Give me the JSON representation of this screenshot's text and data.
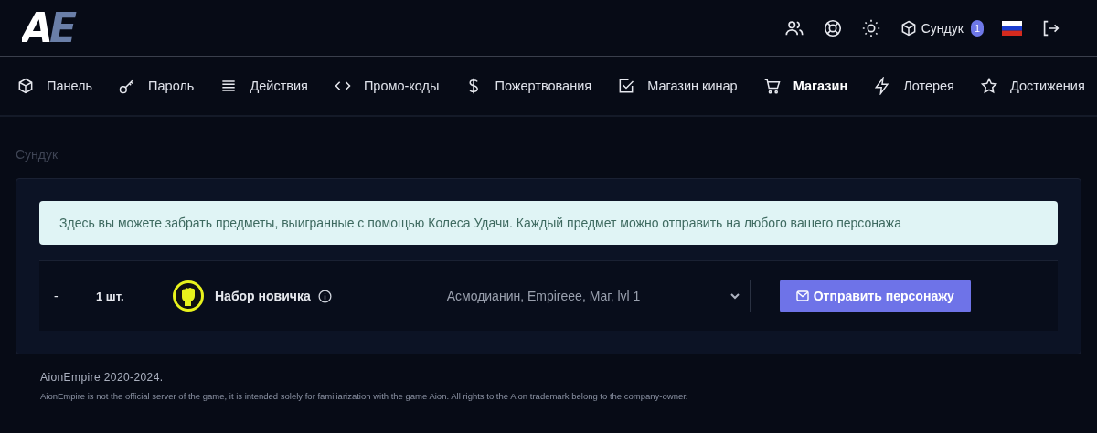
{
  "logo": {
    "text": "AE"
  },
  "header": {
    "chest_label": "Сундук",
    "chest_count": "1"
  },
  "nav": [
    {
      "label": "Панель",
      "selected": false
    },
    {
      "label": "Пароль",
      "selected": false
    },
    {
      "label": "Действия",
      "selected": false
    },
    {
      "label": "Промо-коды",
      "selected": false
    },
    {
      "label": "Пожертвования",
      "selected": false
    },
    {
      "label": "Магазин кинар",
      "selected": false
    },
    {
      "label": "Магазин",
      "selected": true
    },
    {
      "label": "Лотерея",
      "selected": false
    },
    {
      "label": "Достижения",
      "selected": false
    }
  ],
  "breadcrumb": "Сундук",
  "alert": "Здесь вы можете забрать предметы, выигранные с помощью Колеса Удачи. Каждый предмет можно отправить на любого вашего персонажа",
  "items": [
    {
      "column_1": "-",
      "quantity": "1 шт.",
      "name": "Набор новичка",
      "character": "Асмодианин, Empireee, Маг, lvl 1",
      "button": "Отправить персонажу"
    }
  ],
  "footer": {
    "copyright": "AionEmpire 2020-2024.",
    "disclaimer": "AionEmpire is not the official server of the game, it is intended solely for familiarization with the game Aion. All rights to the Aion trademark belong to the company-owner."
  }
}
